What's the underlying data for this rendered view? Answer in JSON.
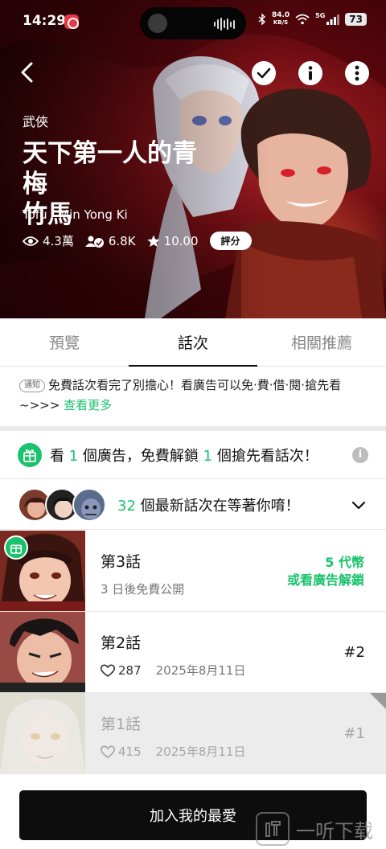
{
  "status_bar": {
    "time": "14:29",
    "net_speed_value": "84.0",
    "net_speed_unit": "KB/S",
    "signal": "5G",
    "battery": "73"
  },
  "hero": {
    "genre": "武俠",
    "title": "天下第一人的青梅\n竹馬",
    "author": "Tofu / Min Yong Ki",
    "views": "4.3萬",
    "subscribers": "6.8K",
    "rating": "10.00",
    "rate_label": "評分",
    "icons": [
      "back-icon",
      "check-icon",
      "info-icon",
      "more-icon",
      "eye-icon",
      "subscribers-icon",
      "star-icon"
    ]
  },
  "tabs": [
    {
      "label": "預覽",
      "active": false
    },
    {
      "label": "話次",
      "active": true
    },
    {
      "label": "相關推薦",
      "active": false
    }
  ],
  "notice": {
    "tag": "通知",
    "text": "免費話次看完了別擔心！看廣告可以免·費·借·閱·搶先看~>>>",
    "link": "查看更多"
  },
  "ad_unlock": {
    "pre": "看 ",
    "count_ads": "1",
    "mid": " 個廣告，免費解鎖 ",
    "count_eps": "1",
    "post": " 個搶先看話次！"
  },
  "latest": {
    "count": "32",
    "text": " 個最新話次在等著你唷！"
  },
  "episodes": [
    {
      "title": "第3話",
      "sub": "3 日後免費公開",
      "unlock_price": "5 代幣",
      "unlock_ad": "或看廣告解鎖"
    },
    {
      "title": "第2話",
      "likes": "287",
      "date": "2025年8月11日",
      "number": "#2"
    },
    {
      "title": "第1話",
      "likes": "415",
      "date": "2025年8月11日",
      "number": "#1"
    }
  ],
  "favorite_button": "加入我的最愛",
  "watermark": "一听下载",
  "colors": {
    "accent_green": "#19c26b",
    "hero_red": "#6e0d12",
    "button_black": "#0d0d0d"
  }
}
